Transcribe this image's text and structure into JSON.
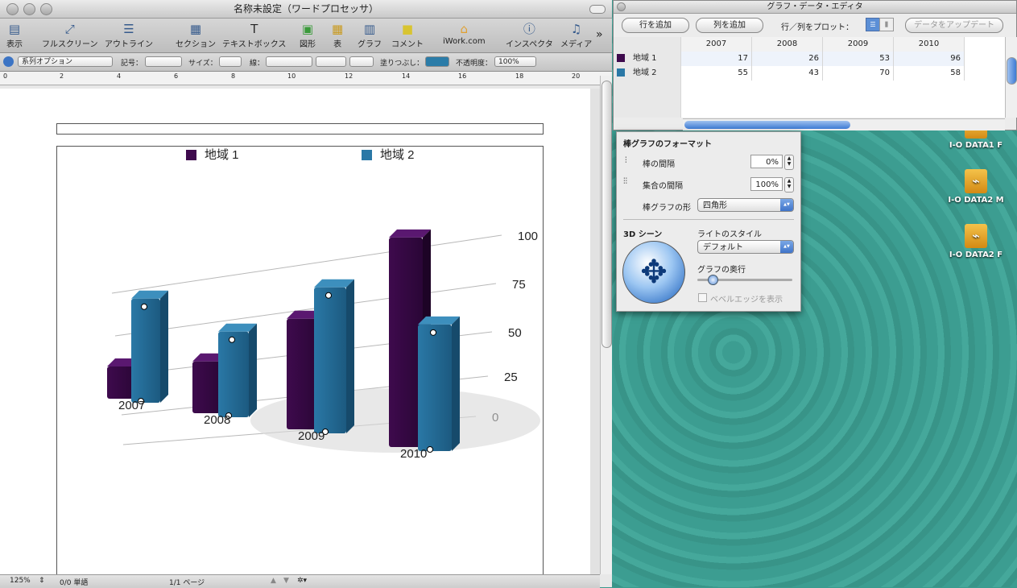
{
  "main_window": {
    "title": "名称未設定（ワードプロセッサ）",
    "toolbar": [
      "表示",
      "フルスクリーン",
      "アウトライン",
      "セクション",
      "テキストボックス",
      "図形",
      "表",
      "グラフ",
      "コメント",
      "iWork.com",
      "インスペクタ",
      "メディア"
    ],
    "format_bar": {
      "style_select": "系列オプション",
      "symbol_label": "記号：",
      "size_label": "サイズ：",
      "line_label": "線：",
      "fill_label": "塗りつぶし：",
      "opacity_label": "不透明度：",
      "opacity_value": "100%",
      "fill_color": "#2b7ca8"
    },
    "ruler_ticks": [
      "0",
      "2",
      "4",
      "6",
      "8",
      "10",
      "12",
      "14",
      "16",
      "18",
      "20"
    ],
    "status": {
      "zoom": "125%",
      "words": "0/0 単語",
      "pages": "1/1 ページ"
    }
  },
  "chart_data": {
    "type": "bar",
    "categories": [
      "2007",
      "2008",
      "2009",
      "2010"
    ],
    "series": [
      {
        "name": "地域 1",
        "values": [
          17,
          26,
          53,
          96
        ],
        "color": "#3e0a4d"
      },
      {
        "name": "地域 2",
        "values": [
          55,
          43,
          70,
          58
        ],
        "color": "#2a78a6"
      }
    ],
    "y_ticks": [
      "0",
      "25",
      "50",
      "75",
      "100"
    ],
    "ylim": [
      0,
      100
    ],
    "legend": "top",
    "grid": true
  },
  "data_editor": {
    "title": "グラフ・データ・エディタ",
    "add_row": "行を追加",
    "add_column": "列を追加",
    "plot_label": "行／列をプロット：",
    "update_button": "データをアップデート",
    "columns": [
      "2007",
      "2008",
      "2009",
      "2010"
    ],
    "rows": [
      {
        "label": "地域 1",
        "values": [
          "17",
          "26",
          "53",
          "96"
        ],
        "color": "#3e0a4d"
      },
      {
        "label": "地域 2",
        "values": [
          "55",
          "43",
          "70",
          "58"
        ],
        "color": "#2a78a6"
      }
    ]
  },
  "inspector": {
    "title": "棒グラフのフォーマット",
    "bar_gap_label": "棒の間隔",
    "bar_gap_value": "0%",
    "set_gap_label": "集合の間隔",
    "set_gap_value": "100%",
    "shape_label": "棒グラフの形",
    "shape_value": "四角形",
    "scene_label": "3D シーン",
    "light_label": "ライトのスタイル",
    "light_value": "デフォルト",
    "depth_label": "グラフの奥行",
    "bevel_label": "ベベルエッジを表示"
  },
  "desktop_icons": [
    "I-O DATA1 F",
    "I-O DATA2 M",
    "I-O DATA2 F"
  ]
}
